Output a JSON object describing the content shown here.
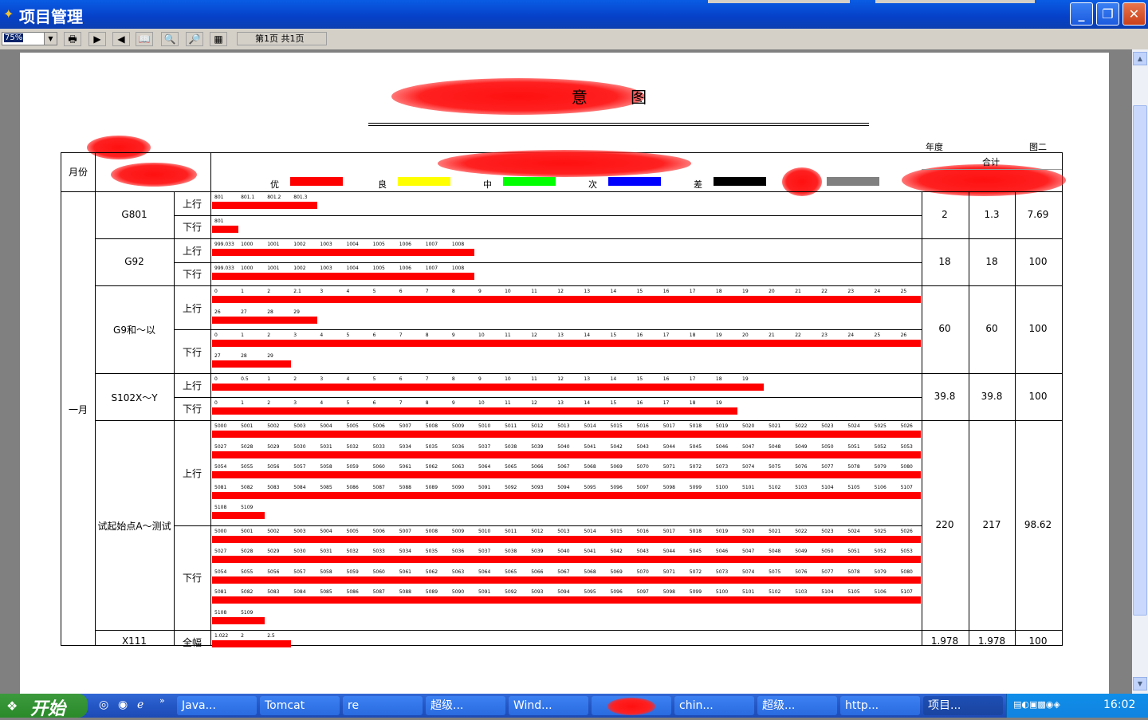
{
  "window": {
    "title": "项目管理",
    "minimize": "_",
    "maximize": "❐",
    "close": "✕"
  },
  "toolbar": {
    "zoom": "75%",
    "page_info": "第1页 共1页",
    "buttons": [
      "🖶",
      "▶",
      "◀",
      "📖",
      "🔍",
      "🔎",
      "▦"
    ]
  },
  "report": {
    "title_visible": "意 图",
    "year_label": "年度",
    "figure_label": "图二",
    "total_label": "合计",
    "month_header": "月份",
    "legend": [
      {
        "label": "优",
        "color": "#ff0000"
      },
      {
        "label": "良",
        "color": "#ffff00"
      },
      {
        "label": "中",
        "color": "#00ff00"
      },
      {
        "label": "次",
        "color": "#0000ff"
      },
      {
        "label": "差",
        "color": "#000000"
      },
      {
        "label": "",
        "color": "#808080"
      }
    ],
    "month": "一月",
    "rows": [
      {
        "road": "G801",
        "totals": [
          "2",
          "1.3",
          "7.69"
        ],
        "dirs": [
          {
            "dir": "上行",
            "lines": [
              {
                "ticks": [
                  "801",
                  "801.1",
                  "801.2",
                  "801.3"
                ],
                "bar": 0.148
              }
            ]
          },
          {
            "dir": "下行",
            "lines": [
              {
                "ticks": [
                  "801"
                ],
                "bar": 0.037
              }
            ]
          }
        ]
      },
      {
        "road": "G92",
        "totals": [
          "18",
          "18",
          "100"
        ],
        "dirs": [
          {
            "dir": "上行",
            "lines": [
              {
                "ticks": [
                  "999.033",
                  "1000",
                  "1001",
                  "1002",
                  "1003",
                  "1004",
                  "1005",
                  "1006",
                  "1007",
                  "1008"
                ],
                "bar": 0.37
              }
            ]
          },
          {
            "dir": "下行",
            "lines": [
              {
                "ticks": [
                  "999.033",
                  "1000",
                  "1001",
                  "1002",
                  "1003",
                  "1004",
                  "1005",
                  "1006",
                  "1007",
                  "1008"
                ],
                "bar": 0.37
              }
            ]
          }
        ]
      },
      {
        "road": "G9和～以",
        "totals": [
          "60",
          "60",
          "100"
        ],
        "dirs": [
          {
            "dir": "上行",
            "lines": [
              {
                "ticks": [
                  "0",
                  "1",
                  "2",
                  "2.1",
                  "3",
                  "4",
                  "5",
                  "6",
                  "7",
                  "8",
                  "9",
                  "10",
                  "11",
                  "12",
                  "13",
                  "14",
                  "15",
                  "16",
                  "17",
                  "18",
                  "19",
                  "20",
                  "21",
                  "22",
                  "23",
                  "24",
                  "25"
                ],
                "bar": 1.0
              },
              {
                "ticks": [
                  "26",
                  "27",
                  "28",
                  "29"
                ],
                "bar": 0.148
              }
            ]
          },
          {
            "dir": "下行",
            "lines": [
              {
                "ticks": [
                  "0",
                  "1",
                  "2",
                  "3",
                  "4",
                  "5",
                  "6",
                  "7",
                  "8",
                  "9",
                  "10",
                  "11",
                  "12",
                  "13",
                  "14",
                  "15",
                  "16",
                  "17",
                  "18",
                  "19",
                  "20",
                  "21",
                  "22",
                  "23",
                  "24",
                  "25",
                  "26"
                ],
                "bar": 1.0
              },
              {
                "ticks": [
                  "27",
                  "28",
                  "29"
                ],
                "bar": 0.111
              }
            ]
          }
        ]
      },
      {
        "road": "S102X～Y",
        "totals": [
          "39.8",
          "39.8",
          "100"
        ],
        "dirs": [
          {
            "dir": "上行",
            "lines": [
              {
                "ticks": [
                  "0",
                  "0.5",
                  "1",
                  "2",
                  "3",
                  "4",
                  "5",
                  "6",
                  "7",
                  "8",
                  "9",
                  "10",
                  "11",
                  "12",
                  "13",
                  "14",
                  "15",
                  "16",
                  "17",
                  "18",
                  "19"
                ],
                "bar": 0.778
              }
            ]
          },
          {
            "dir": "下行",
            "lines": [
              {
                "ticks": [
                  "0",
                  "1",
                  "2",
                  "3",
                  "4",
                  "5",
                  "6",
                  "7",
                  "8",
                  "9",
                  "10",
                  "11",
                  "12",
                  "13",
                  "14",
                  "15",
                  "16",
                  "17",
                  "18",
                  "19"
                ],
                "bar": 0.741
              }
            ]
          }
        ]
      },
      {
        "road": "试起始点A～测试",
        "totals": [
          "220",
          "217",
          "98.62"
        ],
        "dirs": [
          {
            "dir": "上行",
            "lines": [
              {
                "ticks": [
                  "5000",
                  "5001",
                  "5002",
                  "5003",
                  "5004",
                  "5005",
                  "5006",
                  "5007",
                  "5008",
                  "5009",
                  "5010",
                  "5011",
                  "5012",
                  "5013",
                  "5014",
                  "5015",
                  "5016",
                  "5017",
                  "5018",
                  "5019",
                  "5020",
                  "5021",
                  "5022",
                  "5023",
                  "5024",
                  "5025",
                  "5026"
                ],
                "bar": 1.0
              },
              {
                "ticks": [
                  "5027",
                  "5028",
                  "5029",
                  "5030",
                  "5031",
                  "5032",
                  "5033",
                  "5034",
                  "5035",
                  "5036",
                  "5037",
                  "5038",
                  "5039",
                  "5040",
                  "5041",
                  "5042",
                  "5043",
                  "5044",
                  "5045",
                  "5046",
                  "5047",
                  "5048",
                  "5049",
                  "5050",
                  "5051",
                  "5052",
                  "5053"
                ],
                "bar": 1.0
              },
              {
                "ticks": [
                  "5054",
                  "5055",
                  "5056",
                  "5057",
                  "5058",
                  "5059",
                  "5060",
                  "5061",
                  "5062",
                  "5063",
                  "5064",
                  "5065",
                  "5066",
                  "5067",
                  "5068",
                  "5069",
                  "5070",
                  "5071",
                  "5072",
                  "5073",
                  "5074",
                  "5075",
                  "5076",
                  "5077",
                  "5078",
                  "5079",
                  "5080"
                ],
                "bar": 1.0
              },
              {
                "ticks": [
                  "5081",
                  "5082",
                  "5083",
                  "5084",
                  "5085",
                  "5086",
                  "5087",
                  "5088",
                  "5089",
                  "5090",
                  "5091",
                  "5092",
                  "5093",
                  "5094",
                  "5095",
                  "5096",
                  "5097",
                  "5098",
                  "5099",
                  "5100",
                  "5101",
                  "5102",
                  "5103",
                  "5104",
                  "5105",
                  "5106",
                  "5107"
                ],
                "bar": 1.0
              },
              {
                "ticks": [
                  "5108",
                  "5109"
                ],
                "bar": 0.074
              }
            ]
          },
          {
            "dir": "下行",
            "lines": [
              {
                "ticks": [
                  "5000",
                  "5001",
                  "5002",
                  "5003",
                  "5004",
                  "5005",
                  "5006",
                  "5007",
                  "5008",
                  "5009",
                  "5010",
                  "5011",
                  "5012",
                  "5013",
                  "5014",
                  "5015",
                  "5016",
                  "5017",
                  "5018",
                  "5019",
                  "5020",
                  "5021",
                  "5022",
                  "5023",
                  "5024",
                  "5025",
                  "5026"
                ],
                "bar": 1.0
              },
              {
                "ticks": [
                  "5027",
                  "5028",
                  "5029",
                  "5030",
                  "5031",
                  "5032",
                  "5033",
                  "5034",
                  "5035",
                  "5036",
                  "5037",
                  "5038",
                  "5039",
                  "5040",
                  "5041",
                  "5042",
                  "5043",
                  "5044",
                  "5045",
                  "5046",
                  "5047",
                  "5048",
                  "5049",
                  "5050",
                  "5051",
                  "5052",
                  "5053"
                ],
                "bar": 1.0
              },
              {
                "ticks": [
                  "5054",
                  "5055",
                  "5056",
                  "5057",
                  "5058",
                  "5059",
                  "5060",
                  "5061",
                  "5062",
                  "5063",
                  "5064",
                  "5065",
                  "5066",
                  "5067",
                  "5068",
                  "5069",
                  "5070",
                  "5071",
                  "5072",
                  "5073",
                  "5074",
                  "5075",
                  "5076",
                  "5077",
                  "5078",
                  "5079",
                  "5080"
                ],
                "bar": 1.0
              },
              {
                "ticks": [
                  "5081",
                  "5082",
                  "5083",
                  "5084",
                  "5085",
                  "5086",
                  "5087",
                  "5088",
                  "5089",
                  "5090",
                  "5091",
                  "5092",
                  "5093",
                  "5094",
                  "5095",
                  "5096",
                  "5097",
                  "5098",
                  "5099",
                  "5100",
                  "5101",
                  "5102",
                  "5103",
                  "5104",
                  "5105",
                  "5106",
                  "5107"
                ],
                "bar": 1.0
              },
              {
                "ticks": [
                  "5108",
                  "5109"
                ],
                "bar": 0.074
              }
            ]
          }
        ]
      },
      {
        "road": "X111",
        "totals": [
          "1.978",
          "1.978",
          "100"
        ],
        "dirs": [
          {
            "dir": "全幅",
            "lines": [
              {
                "ticks": [
                  "1.022",
                  "2",
                  "2.5"
                ],
                "bar": 0.111
              }
            ]
          }
        ]
      }
    ]
  },
  "taskbar": {
    "start": "开始",
    "quicklaunch": [
      "◎",
      "◉",
      "ℯ",
      "»"
    ],
    "tasks": [
      "Java...",
      "Tomcat",
      "re",
      "超级...",
      "Wind...",
      "",
      "chin...",
      "超级...",
      "http...",
      "项目..."
    ],
    "clock": "16:02"
  }
}
